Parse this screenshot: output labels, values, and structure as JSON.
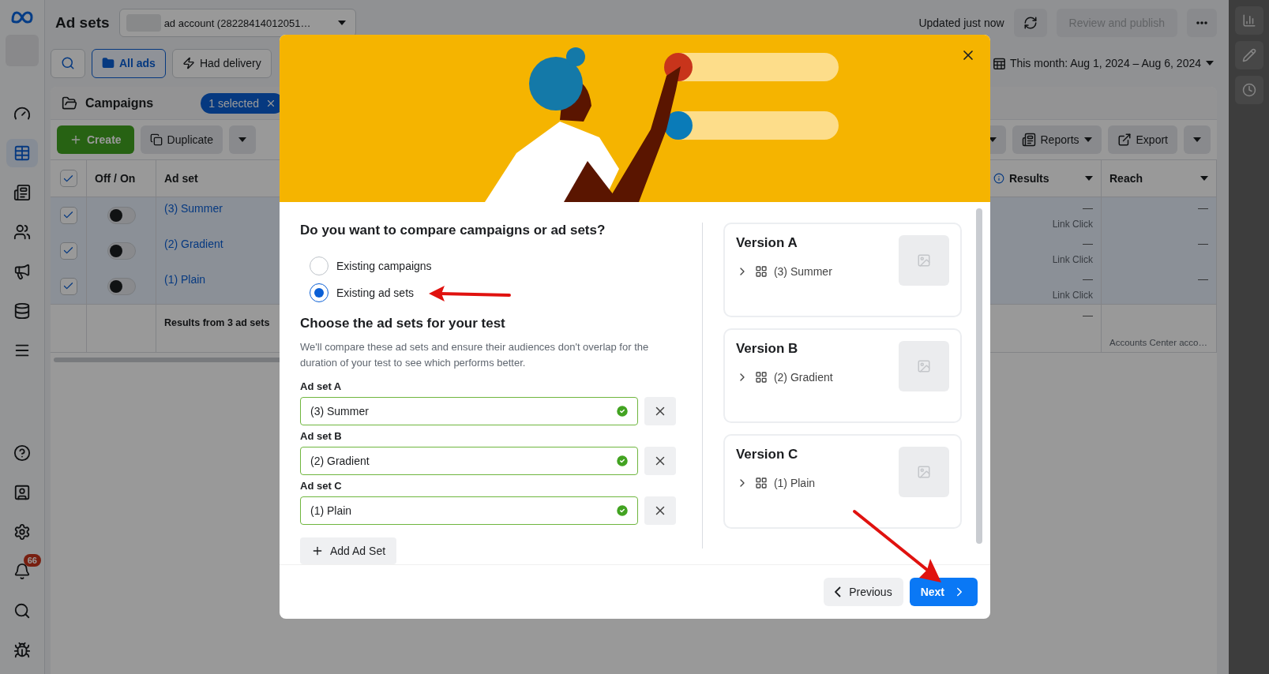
{
  "header": {
    "title": "Ad sets",
    "account": "ad account (28228414012051…",
    "updated": "Updated just now",
    "publish_button": "Review and publish"
  },
  "filters": [
    {
      "label": "All ads",
      "selected": true
    },
    {
      "label": "Had delivery",
      "selected": false
    }
  ],
  "date_range": "This month: Aug 1, 2024 – Aug 6, 2024",
  "campaigns_bar": {
    "label": "Campaigns",
    "chip": "1 selected"
  },
  "toolbar": {
    "create": "Create",
    "duplicate": "Duplicate",
    "reports": "Reports",
    "export": "Export"
  },
  "table": {
    "header_checked": true,
    "columns": [
      "Off / On",
      "Ad set",
      "Results",
      "Reach"
    ],
    "rows": [
      {
        "checked": true,
        "on": false,
        "name": "(3) Summer",
        "results": "—",
        "result_type": "Link Click",
        "reach": "—"
      },
      {
        "checked": true,
        "on": false,
        "name": "(2) Gradient",
        "results": "—",
        "result_type": "Link Click",
        "reach": "—"
      },
      {
        "checked": true,
        "on": false,
        "name": "(1) Plain",
        "results": "—",
        "result_type": "Link Click",
        "reach": "—"
      }
    ],
    "summary": {
      "label": "Results from 3 ad sets",
      "results": "—",
      "reach": "Accounts Center acco…"
    }
  },
  "notification_badge": "66",
  "modal": {
    "question": "Do you want to compare campaigns or ad sets?",
    "options": [
      {
        "label": "Existing campaigns",
        "selected": false
      },
      {
        "label": "Existing ad sets",
        "selected": true
      }
    ],
    "section_title": "Choose the ad sets for your test",
    "description": "We'll compare these ad sets and ensure their audiences don't overlap for the duration of your test to see which performs better.",
    "fields": [
      {
        "label": "Ad set A",
        "value": "(3) Summer",
        "valid": true
      },
      {
        "label": "Ad set B",
        "value": "(2) Gradient",
        "valid": true
      },
      {
        "label": "Ad set C",
        "value": "(1) Plain",
        "valid": true
      }
    ],
    "add_button": "Add Ad Set",
    "versions": [
      {
        "title": "Version A",
        "item": "(3) Summer"
      },
      {
        "title": "Version B",
        "item": "(2) Gradient"
      },
      {
        "title": "Version C",
        "item": "(1) Plain"
      }
    ],
    "previous": "Previous",
    "next": "Next"
  }
}
